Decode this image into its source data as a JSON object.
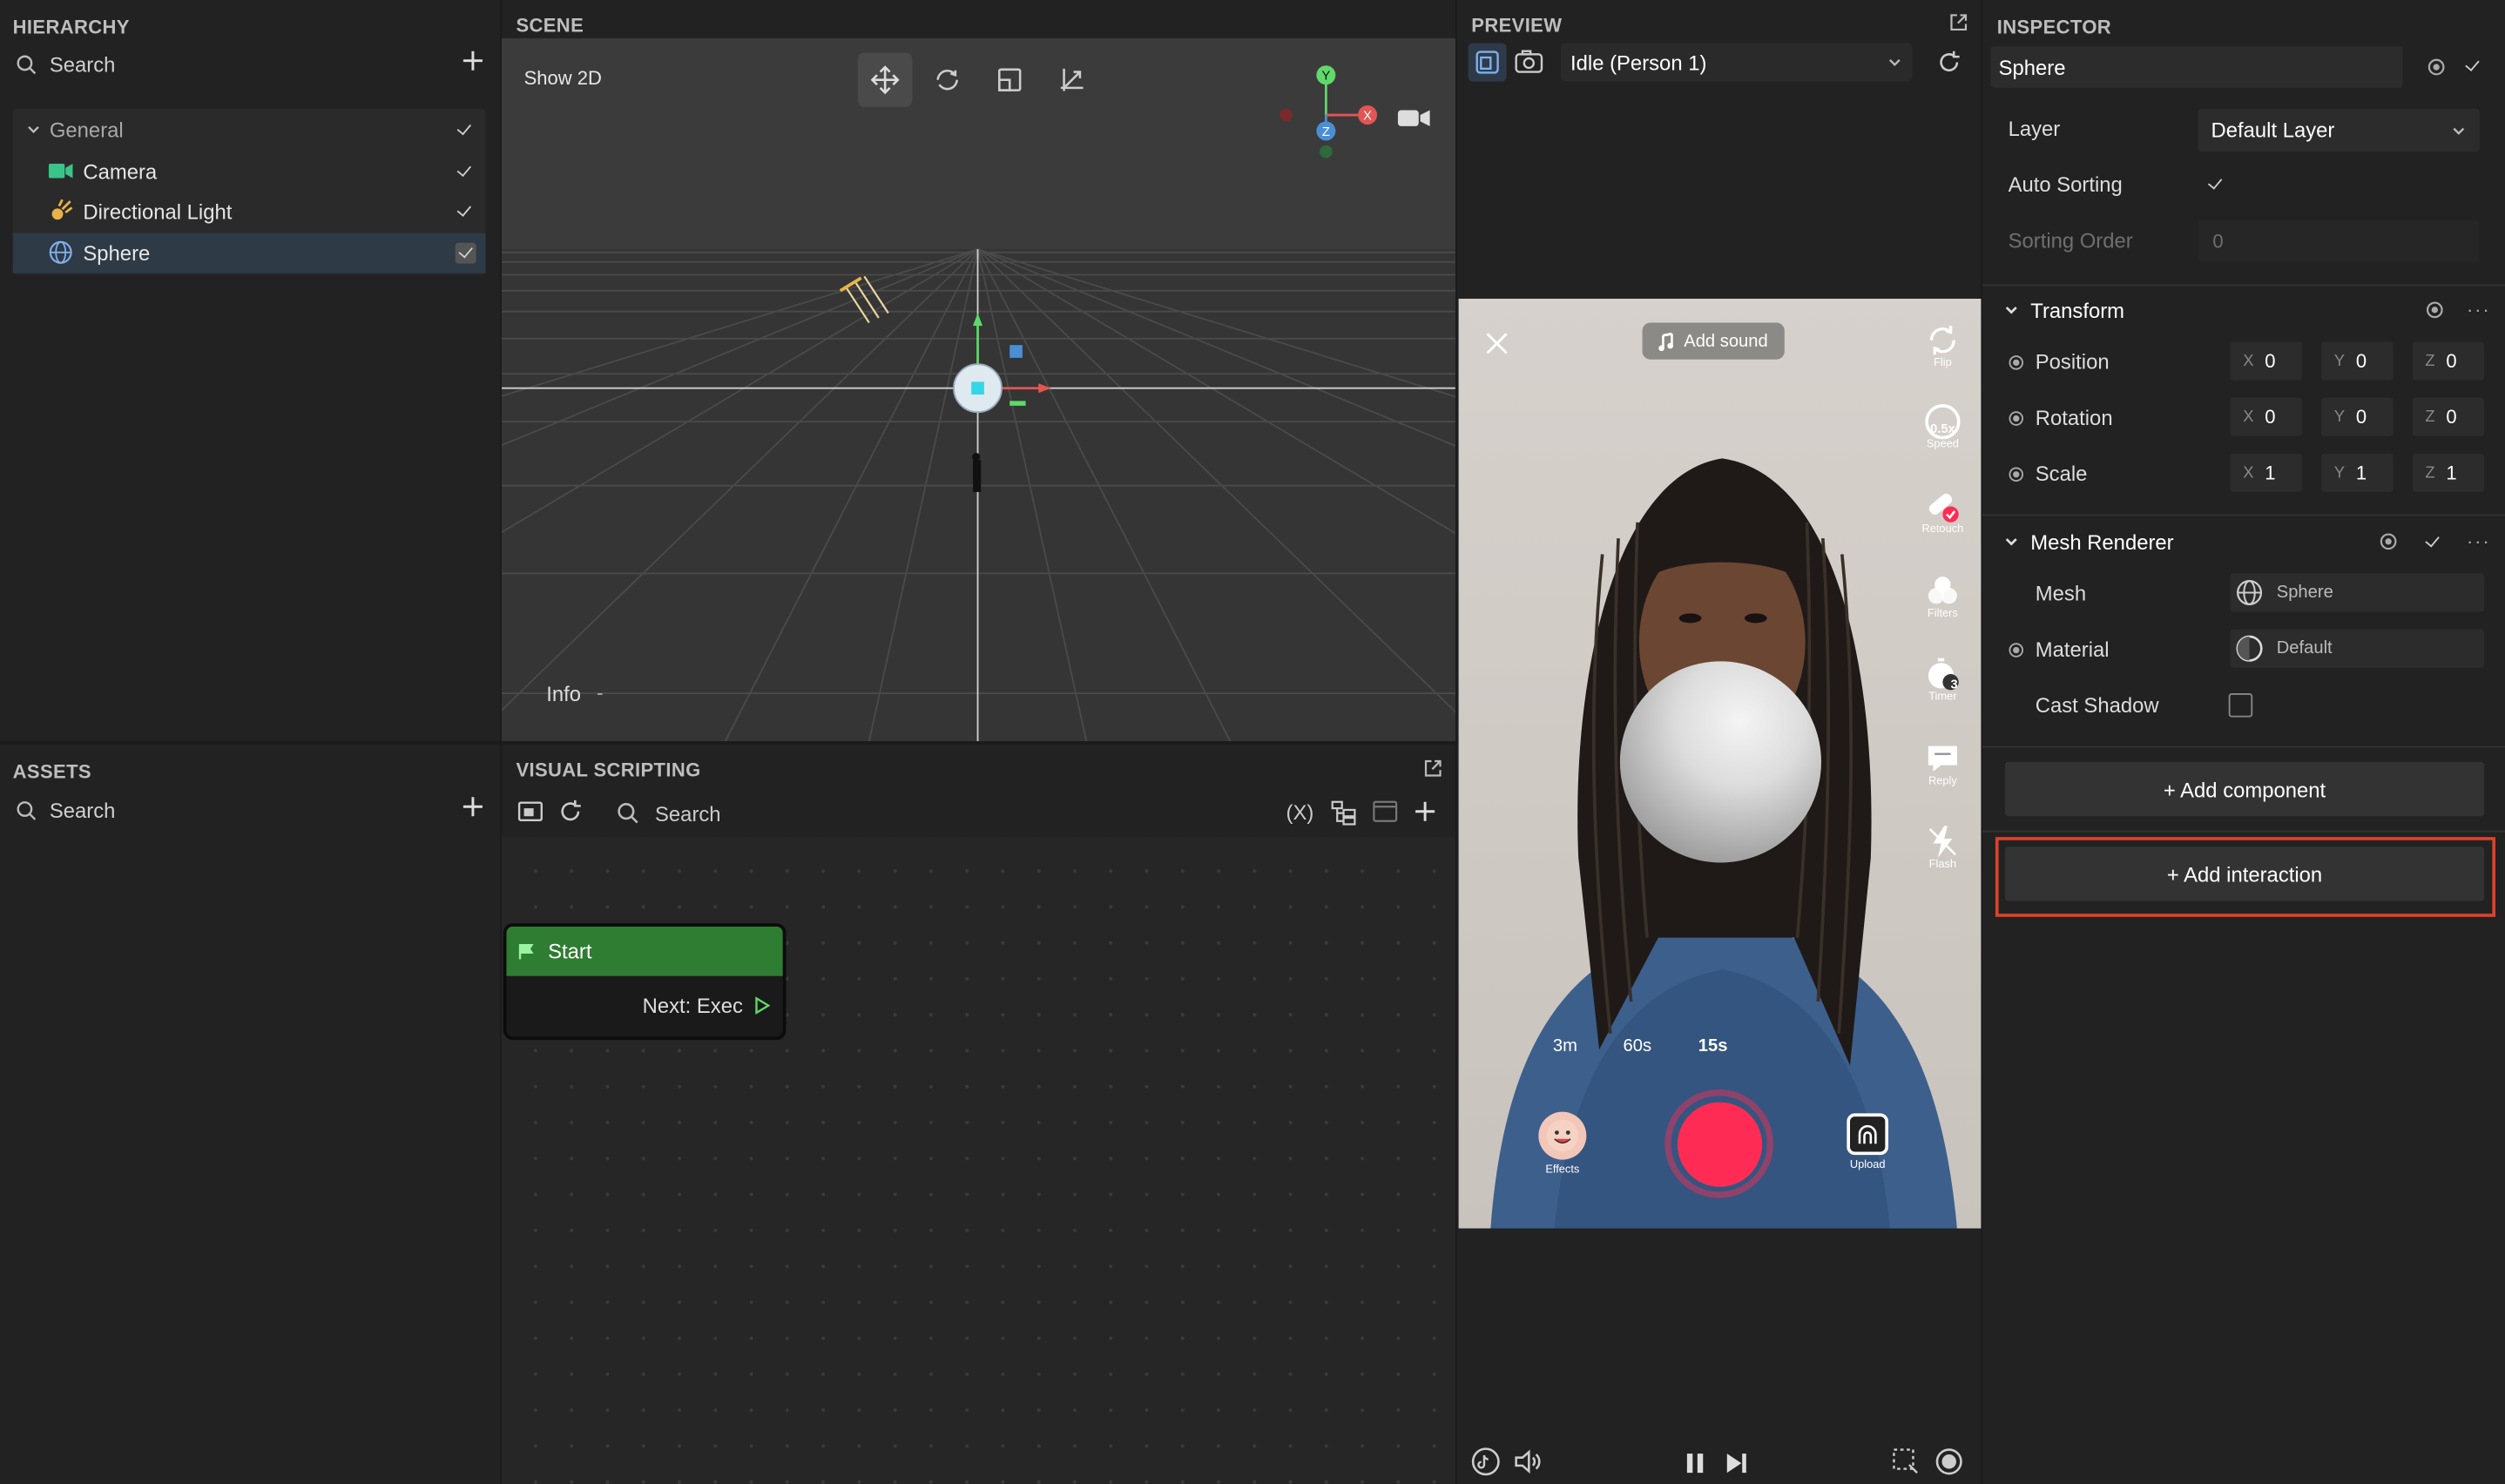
{
  "hierarchy": {
    "title": "HIERARCHY",
    "search_placeholder": "Search",
    "group": "General",
    "items": [
      {
        "label": "Camera",
        "icon": "camera-icon"
      },
      {
        "label": "Directional Light",
        "icon": "light-icon"
      },
      {
        "label": "Sphere",
        "icon": "sphere-icon"
      }
    ]
  },
  "assets": {
    "title": "ASSETS",
    "search_placeholder": "Search"
  },
  "scene": {
    "title": "SCENE",
    "show2d": "Show 2D",
    "info": "Info",
    "gizmo": {
      "y": "Y",
      "x": "X",
      "z": "Z"
    }
  },
  "visual_scripting": {
    "title": "VISUAL SCRIPTING",
    "search_placeholder": "Search",
    "var_button": "(X)",
    "node": {
      "title": "Start",
      "port": "Next: Exec"
    }
  },
  "preview": {
    "title": "PREVIEW",
    "dropdown": "Idle (Person 1)",
    "add_sound": "Add sound",
    "side": [
      {
        "label": "Flip"
      },
      {
        "label": "Speed",
        "badge": "0.5x"
      },
      {
        "label": "Retouch"
      },
      {
        "label": "Filters"
      },
      {
        "label": "Timer",
        "badge": "3"
      },
      {
        "label": "Reply"
      },
      {
        "label": "Flash"
      }
    ],
    "durations": [
      "3m",
      "60s",
      "15s"
    ],
    "effects": "Effects",
    "upload": "Upload"
  },
  "inspector": {
    "title": "INSPECTOR",
    "object_name": "Sphere",
    "layer_label": "Layer",
    "layer_value": "Default Layer",
    "auto_sorting": "Auto Sorting",
    "sorting_order": "Sorting Order",
    "sorting_value": "0",
    "transform": {
      "title": "Transform",
      "rows": [
        {
          "label": "Position",
          "x": "0",
          "y": "0",
          "z": "0"
        },
        {
          "label": "Rotation",
          "x": "0",
          "y": "0",
          "z": "0"
        },
        {
          "label": "Scale",
          "x": "1",
          "y": "1",
          "z": "1"
        }
      ]
    },
    "mesh_renderer": {
      "title": "Mesh Renderer",
      "mesh_label": "Mesh",
      "mesh_value": "Sphere",
      "material_label": "Material",
      "material_value": "Default",
      "cast_shadow": "Cast Shadow"
    },
    "add_component": "+ Add component",
    "add_interaction": "+ Add interaction"
  },
  "colors": {
    "accent_highlight": "#e0402a",
    "node_green": "#2e7d32",
    "record": "#fe2c55"
  }
}
